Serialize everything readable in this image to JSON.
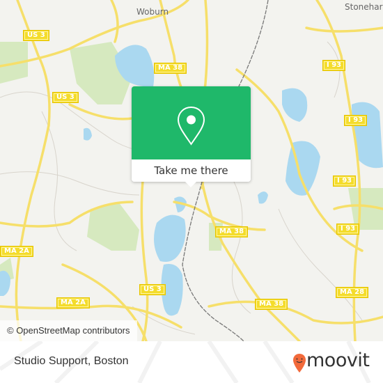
{
  "map": {
    "places": [
      {
        "name": "Woburn"
      },
      {
        "name": "Stonehar"
      }
    ],
    "shields": [
      {
        "label": "US 3"
      },
      {
        "label": "US 3"
      },
      {
        "label": "MA 38"
      },
      {
        "label": "I 93"
      },
      {
        "label": "I 93"
      },
      {
        "label": "I 93"
      },
      {
        "label": "I 93"
      },
      {
        "label": "MA 38"
      },
      {
        "label": "MA 2A"
      },
      {
        "label": "US 3"
      },
      {
        "label": "MA 2A"
      },
      {
        "label": "MA 38"
      },
      {
        "label": "MA 28"
      }
    ],
    "attribution": "© OpenStreetMap contributors",
    "colors": {
      "land": "#f3f3ef",
      "water": "#aad8f0",
      "park": "#cfe5b4",
      "road": "#f6df6a",
      "rail": "#777777"
    }
  },
  "popup": {
    "icon": "location-pin-icon",
    "button_label": "Take me there",
    "color": "#1fb86a"
  },
  "footer": {
    "title": "Studio Support, Boston",
    "brand": "moovit",
    "brand_color": "#f26a3b"
  }
}
